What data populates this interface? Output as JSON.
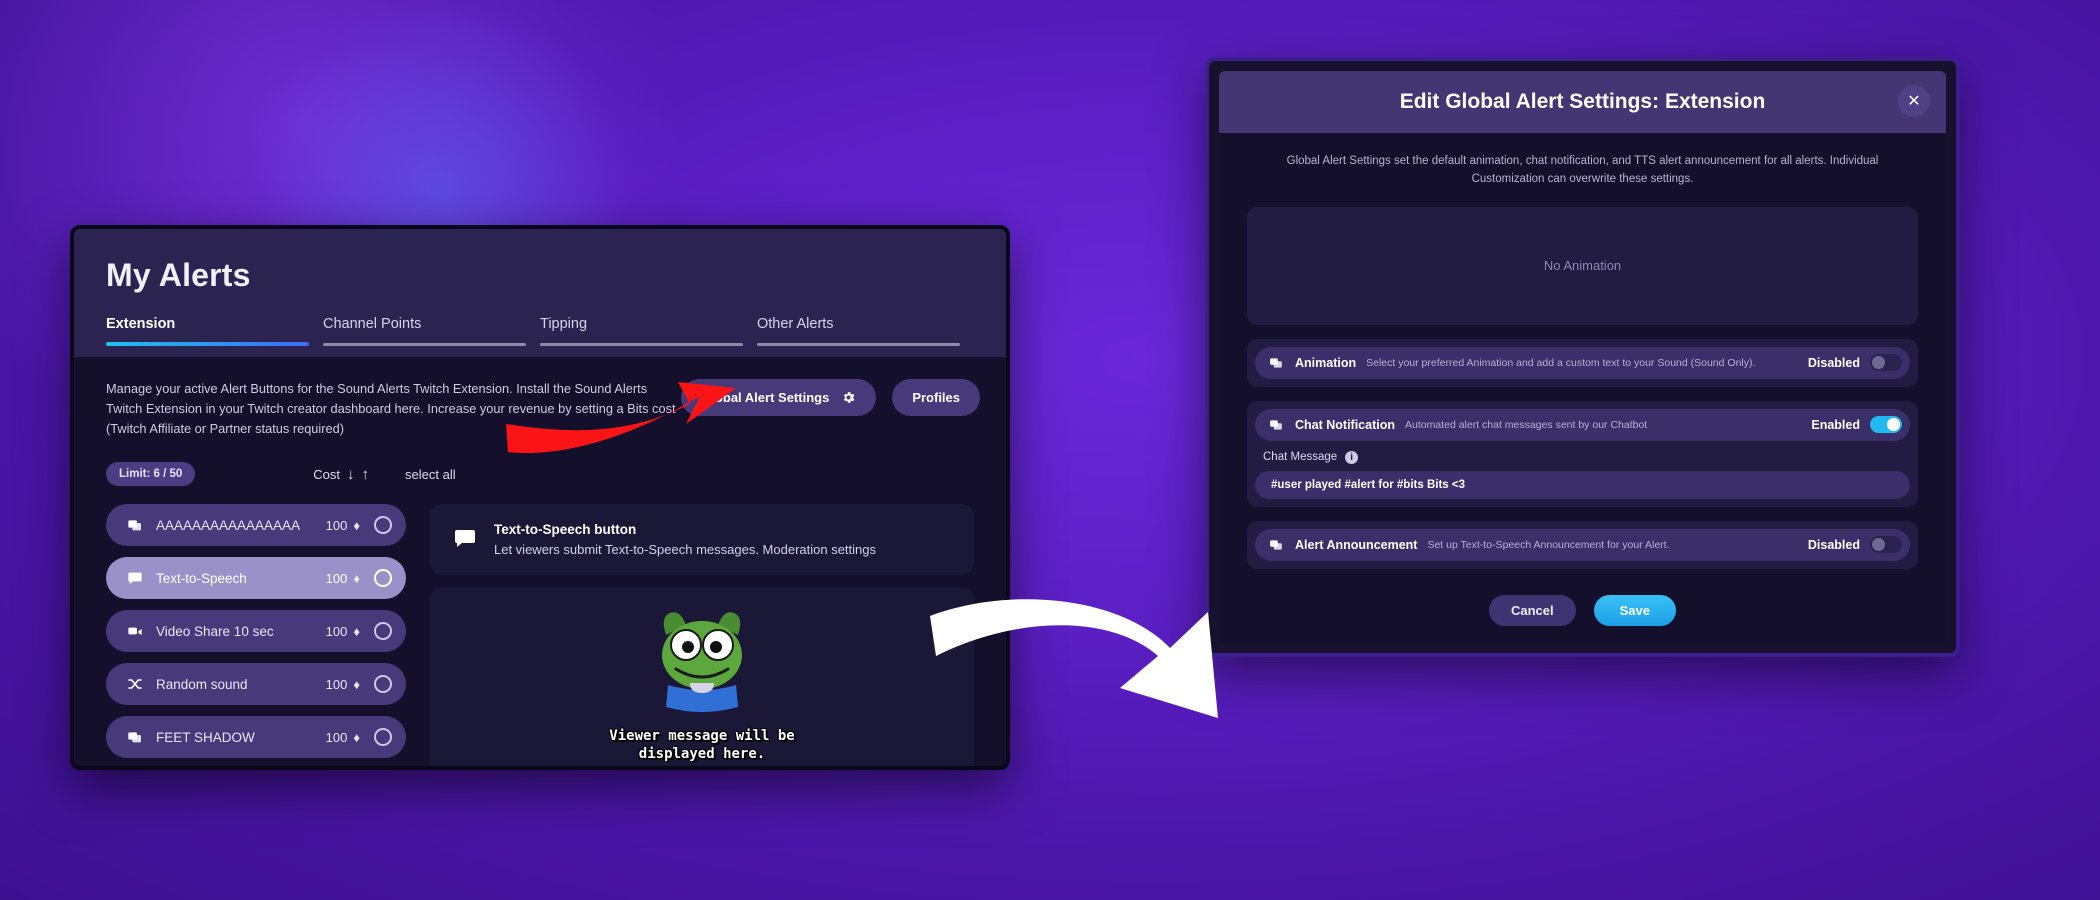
{
  "alerts_window": {
    "title": "My Alerts",
    "tabs": [
      {
        "label": "Extension",
        "active": true
      },
      {
        "label": "Channel Points",
        "active": false
      },
      {
        "label": "Tipping",
        "active": false
      },
      {
        "label": "Other Alerts",
        "active": false
      }
    ],
    "description": "Manage your active Alert Buttons for the Sound Alerts Twitch Extension. Install the Sound Alerts Twitch Extension in your Twitch creator dashboard here. Increase your revenue by setting a Bits cost (Twitch Affiliate or Partner status required)",
    "global_alert_settings_button": "Global Alert Settings",
    "global_alert_settings_icon": "gear-icon",
    "profiles_button": "Profiles",
    "limit_badge": "Limit: 6 / 50",
    "cost_label": "Cost",
    "sort_down_icon": "arrow-down-icon",
    "sort_up_icon": "arrow-up-icon",
    "select_all_label": "select all",
    "alert_items": [
      {
        "icon": "image-stack-icon",
        "label": "AAAAAAAAAAAAAAAA",
        "cost": "100",
        "bits_icon": "bits-icon",
        "selected": false
      },
      {
        "icon": "speech-bubble-icon",
        "label": "Text-to-Speech",
        "cost": "100",
        "bits_icon": "bits-icon",
        "selected": true
      },
      {
        "icon": "video-camera-icon",
        "label": "Video Share 10 sec",
        "cost": "100",
        "bits_icon": "bits-icon",
        "selected": false
      },
      {
        "icon": "shuffle-icon",
        "label": "Random sound",
        "cost": "100",
        "bits_icon": "bits-icon",
        "selected": false
      },
      {
        "icon": "image-stack-icon",
        "label": "FEET SHADOW",
        "cost": "100",
        "bits_icon": "bits-icon",
        "selected": false
      }
    ],
    "detail_card": {
      "icon": "speech-bubble-icon",
      "title": "Text-to-Speech button",
      "subtitle": "Let viewers submit Text-to-Speech messages. Moderation settings"
    },
    "preview": {
      "emote": "pepe-frog-emote",
      "message_line1": "Viewer message will be",
      "message_line2": "displayed here."
    }
  },
  "modal": {
    "title": "Edit Global Alert Settings: Extension",
    "close_icon": "close-icon",
    "description": "Global Alert Settings set the default animation, chat notification, and TTS alert announcement for all alerts. Individual Customization can overwrite these settings.",
    "animation_preview_text": "No Animation",
    "settings": [
      {
        "icon": "image-icon",
        "name": "Animation",
        "description": "Select your preferred Animation and add a custom text to your Sound (Sound Only).",
        "state": "Disabled",
        "enabled": false
      },
      {
        "icon": "image-icon",
        "name": "Chat Notification",
        "description": "Automated alert chat messages sent by our Chatbot",
        "state": "Enabled",
        "enabled": true
      }
    ],
    "chat_message": {
      "label": "Chat Message",
      "info_icon": "info-icon",
      "value": "#user played #alert for #bits Bits <3"
    },
    "alert_announcement": {
      "icon": "image-icon",
      "name": "Alert Announcement",
      "description": "Set up Text-to-Speech Announcement for your Alert.",
      "state": "Disabled",
      "enabled": false
    },
    "cancel_button": "Cancel",
    "save_button": "Save"
  },
  "annotations": {
    "red_arrow": "red-arrow-pointing-to-global-alert-settings",
    "white_arrow": "white-arrow-pointing-to-modal"
  },
  "colors": {
    "accent_blue": "#22b8f0",
    "purple_panel": "#463a7a",
    "dark_bg": "#14102b",
    "red_arrow": "#fb1416",
    "white_arrow": "#ffffff"
  }
}
